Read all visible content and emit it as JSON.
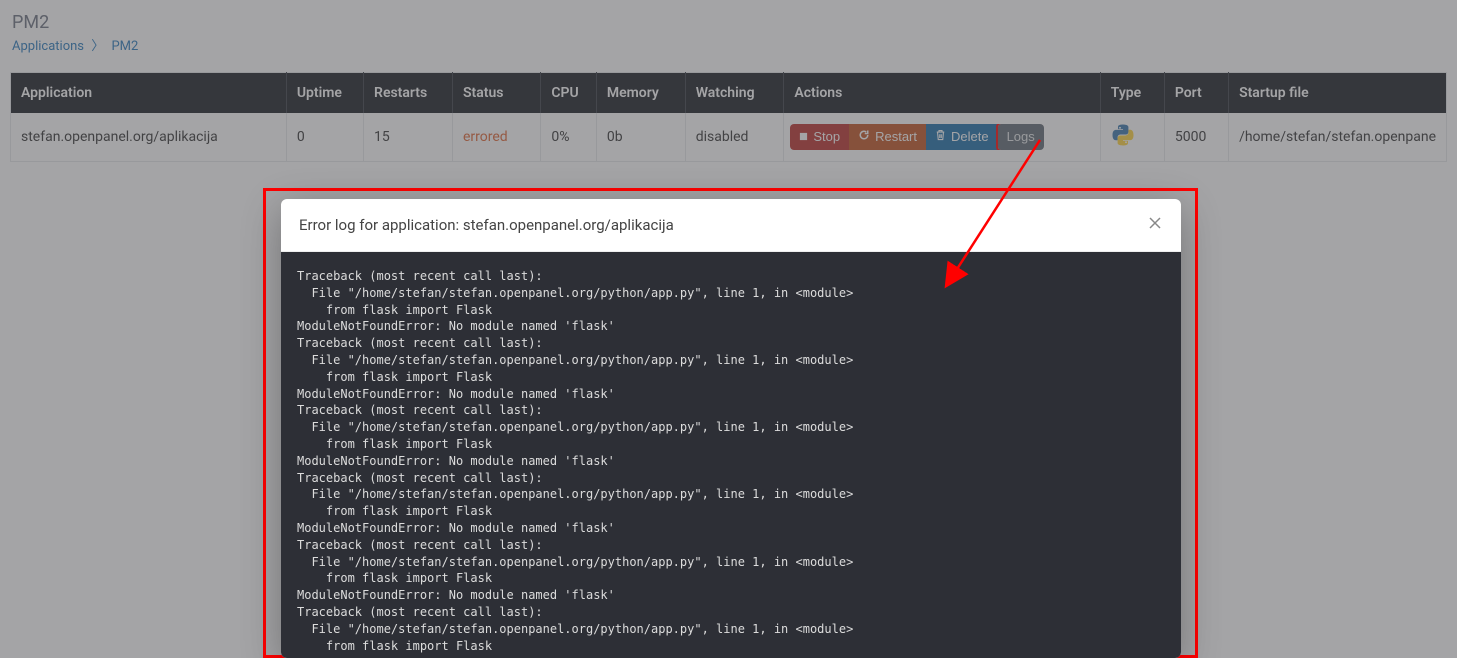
{
  "header": {
    "title": "PM2",
    "breadcrumb": {
      "root": "Applications",
      "current": "PM2"
    }
  },
  "table": {
    "columns": [
      "Application",
      "Uptime",
      "Restarts",
      "Status",
      "CPU",
      "Memory",
      "Watching",
      "Actions",
      "Type",
      "Port",
      "Startup file"
    ],
    "row": {
      "application": "stefan.openpanel.org/aplikacija",
      "uptime": "0",
      "restarts": "15",
      "status": "errored",
      "cpu": "0%",
      "memory": "0b",
      "watching": "disabled",
      "actions": {
        "stop": "Stop",
        "restart": "Restart",
        "delete": "Delete",
        "logs": "Logs"
      },
      "type_icon": "python-icon",
      "port": "5000",
      "startup": "/home/stefan/stefan.openpane"
    }
  },
  "modal": {
    "title": "Error log for application: stefan.openpanel.org/aplikacija",
    "log": "Traceback (most recent call last):\n  File \"/home/stefan/stefan.openpanel.org/python/app.py\", line 1, in <module>\n    from flask import Flask\nModuleNotFoundError: No module named 'flask'\nTraceback (most recent call last):\n  File \"/home/stefan/stefan.openpanel.org/python/app.py\", line 1, in <module>\n    from flask import Flask\nModuleNotFoundError: No module named 'flask'\nTraceback (most recent call last):\n  File \"/home/stefan/stefan.openpanel.org/python/app.py\", line 1, in <module>\n    from flask import Flask\nModuleNotFoundError: No module named 'flask'\nTraceback (most recent call last):\n  File \"/home/stefan/stefan.openpanel.org/python/app.py\", line 1, in <module>\n    from flask import Flask\nModuleNotFoundError: No module named 'flask'\nTraceback (most recent call last):\n  File \"/home/stefan/stefan.openpanel.org/python/app.py\", line 1, in <module>\n    from flask import Flask\nModuleNotFoundError: No module named 'flask'\nTraceback (most recent call last):\n  File \"/home/stefan/stefan.openpanel.org/python/app.py\", line 1, in <module>\n    from flask import Flask"
  }
}
